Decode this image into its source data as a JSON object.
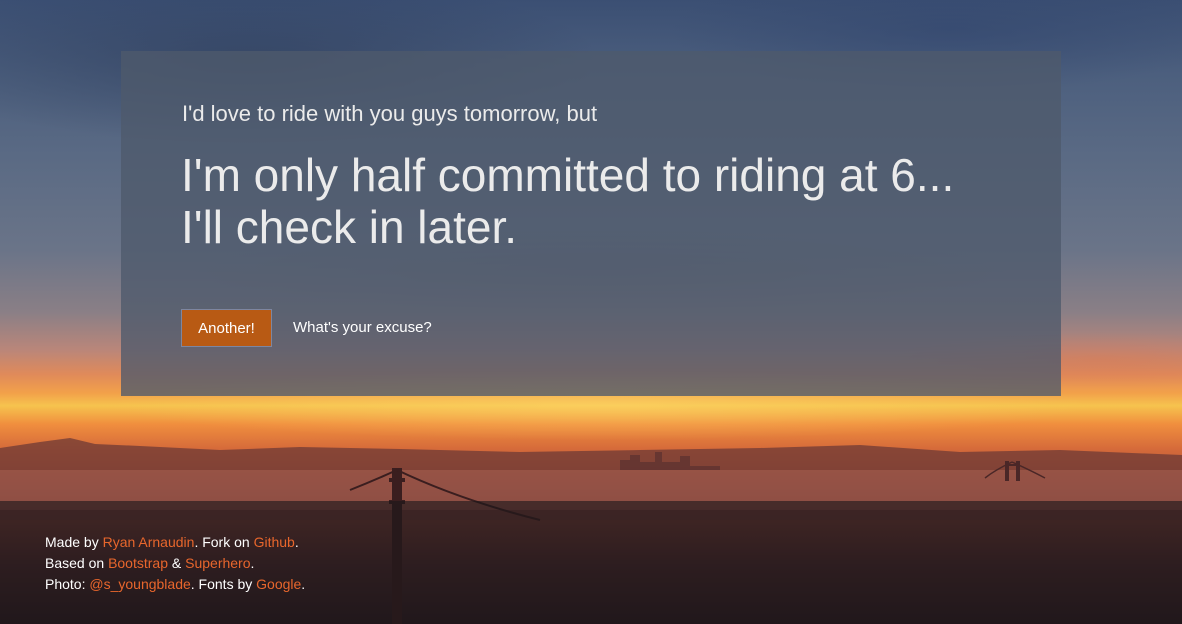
{
  "card": {
    "lead": "I'd love to ride with you guys tomorrow, but",
    "excuse": "I'm only half committed to riding at 6... I'll check in later.",
    "another_button": "Another!",
    "whats_your_excuse_link": "What's your excuse?"
  },
  "footer": {
    "line1": {
      "made_by": "Made by ",
      "author_link": "Ryan Arnaudin",
      "fork_on": ". Fork on ",
      "github_link": "Github",
      "end": "."
    },
    "line2": {
      "based_on": "Based on ",
      "bootstrap_link": "Bootstrap",
      "amp": " & ",
      "superhero_link": "Superhero",
      "end": "."
    },
    "line3": {
      "photo": "Photo: ",
      "photographer_link": "@s_youngblade",
      "fonts_by": ". Fonts by ",
      "google_link": "Google",
      "end": "."
    }
  },
  "colors": {
    "accent": "#e8662c",
    "button": "#b85a14",
    "card_overlay": "#4e5a6c"
  }
}
